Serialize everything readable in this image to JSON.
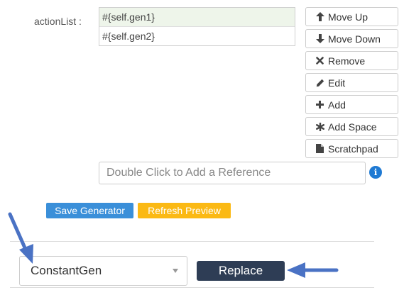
{
  "action_list": {
    "label": "actionList :",
    "items": [
      "#{self.gen1}",
      "#{self.gen2}"
    ]
  },
  "side_buttons": {
    "move_up": "Move Up",
    "move_down": "Move Down",
    "remove": "Remove",
    "edit": "Edit",
    "add": "Add",
    "add_space": "Add Space",
    "scratchpad": "Scratchpad"
  },
  "reference_input": {
    "placeholder": "Double Click to Add a Reference",
    "value": ""
  },
  "info_icon": {
    "glyph": "i",
    "icon": "info-circle-icon"
  },
  "generator_buttons": {
    "save": "Save Generator",
    "refresh": "Refresh Preview"
  },
  "generator_select": {
    "selected": "ConstantGen"
  },
  "replace_button": "Replace",
  "colors": {
    "save": "#3a8fd9",
    "refresh": "#fbb914",
    "replace": "#2e3d55",
    "annotation_arrow": "#4a72c4",
    "info": "#1f7ad3"
  }
}
